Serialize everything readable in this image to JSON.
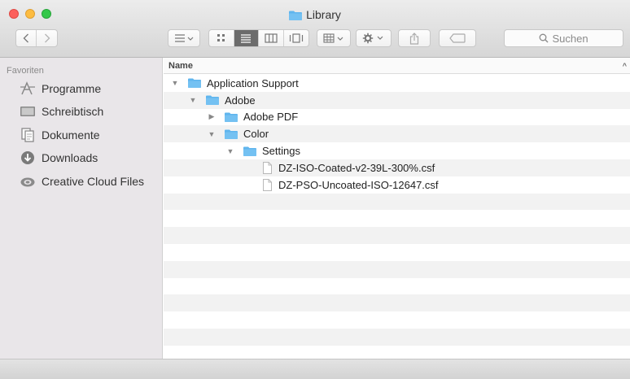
{
  "window": {
    "title": "Library"
  },
  "toolbar": {
    "search_placeholder": "Suchen"
  },
  "sidebar": {
    "section": "Favoriten",
    "items": [
      {
        "label": "Programme",
        "icon": "applications-icon"
      },
      {
        "label": "Schreibtisch",
        "icon": "desktop-icon"
      },
      {
        "label": "Dokumente",
        "icon": "documents-icon"
      },
      {
        "label": "Downloads",
        "icon": "downloads-icon"
      },
      {
        "label": "Creative Cloud Files",
        "icon": "creative-cloud-icon"
      }
    ]
  },
  "list": {
    "column_name": "Name",
    "rows": [
      {
        "name": "Application Support",
        "type": "folder",
        "expanded": true
      },
      {
        "name": "Adobe",
        "type": "folder",
        "expanded": true
      },
      {
        "name": "Adobe PDF",
        "type": "folder",
        "expanded": false
      },
      {
        "name": "Color",
        "type": "folder",
        "expanded": true
      },
      {
        "name": "Settings",
        "type": "folder",
        "expanded": true
      },
      {
        "name": "DZ-ISO-Coated-v2-39L-300%.csf",
        "type": "file"
      },
      {
        "name": "DZ-PSO-Uncoated-ISO-12647.csf",
        "type": "file"
      }
    ]
  },
  "colors": {
    "folder_blue": "#5fb5ee",
    "sidebar_bg": "#e9e6e9"
  }
}
